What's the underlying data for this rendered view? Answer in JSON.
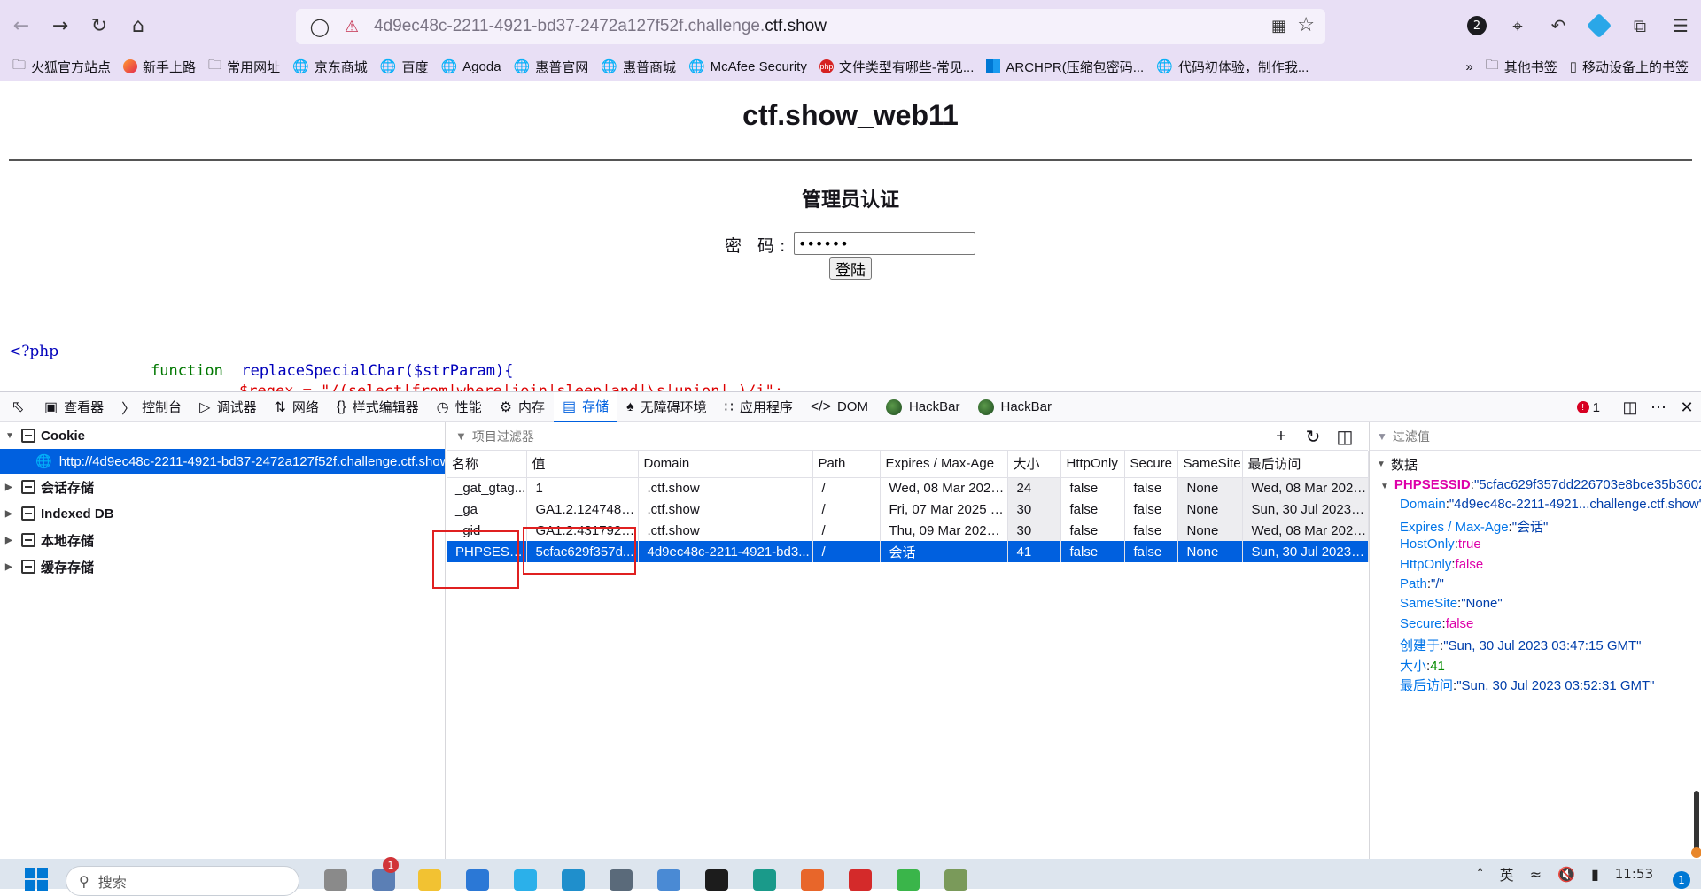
{
  "browser": {
    "url_prefix": "4d9ec48c-2211-4921-bd37-2472a127f52f.challenge.",
    "url_domain": "ctf.show",
    "notif_count": "2",
    "bookmarks": [
      {
        "label": "火狐官方站点",
        "icon": "folder-icon"
      },
      {
        "label": "新手上路",
        "icon": "firefox-icon"
      },
      {
        "label": "常用网址",
        "icon": "folder-icon"
      },
      {
        "label": "京东商城",
        "icon": "globe-icon"
      },
      {
        "label": "百度",
        "icon": "globe-icon"
      },
      {
        "label": "Agoda",
        "icon": "globe-icon"
      },
      {
        "label": "惠普官网",
        "icon": "globe-icon"
      },
      {
        "label": "惠普商城",
        "icon": "globe-icon"
      },
      {
        "label": "McAfee Security",
        "icon": "globe-icon"
      },
      {
        "label": "文件类型有哪些-常见...",
        "icon": "php-icon"
      },
      {
        "label": "ARCHPR(压缩包密码...",
        "icon": "microsoft-icon"
      },
      {
        "label": "代码初体验，制作我...",
        "icon": "globe-icon"
      }
    ],
    "other_bookmarks": "其他书签",
    "mobile_bookmarks": "移动设备上的书签"
  },
  "page": {
    "title": "ctf.show_web11",
    "heading": "管理员认证",
    "password_label": "密 码:",
    "password_value": "••••••",
    "login_button": "登陆",
    "php_open": "<?php",
    "php_keyword": "function",
    "php_function": "replaceSpecialChar($strParam){",
    "php_next_line": "$regex = \"/(select|from|where|join|sleep|and|\\s|union|,)/i\";"
  },
  "devtools": {
    "tabs": [
      {
        "label": "查看器",
        "icon": "inspector-icon"
      },
      {
        "label": "控制台",
        "icon": "console-icon"
      },
      {
        "label": "调试器",
        "icon": "debugger-icon"
      },
      {
        "label": "网络",
        "icon": "network-icon"
      },
      {
        "label": "样式编辑器",
        "icon": "style-editor-icon"
      },
      {
        "label": "性能",
        "icon": "performance-icon"
      },
      {
        "label": "内存",
        "icon": "memory-icon"
      },
      {
        "label": "存储",
        "icon": "storage-icon"
      },
      {
        "label": "无障碍环境",
        "icon": "accessibility-icon"
      },
      {
        "label": "应用程序",
        "icon": "application-icon"
      },
      {
        "label": "DOM",
        "icon": "dom-icon"
      },
      {
        "label": "HackBar",
        "icon": "hackbar-icon"
      },
      {
        "label": "HackBar",
        "icon": "hackbar-icon"
      }
    ],
    "active_tab": "存储",
    "error_count": "1",
    "sidebar": {
      "cookie": "Cookie",
      "cookie_host": "http://4d9ec48c-2211-4921-bd37-2472a127f52f.challenge.ctf.show",
      "session_storage": "会话存储",
      "indexed_db": "Indexed DB",
      "local_storage": "本地存储",
      "cache_storage": "缓存存储"
    },
    "filter_placeholder": "项目过滤器",
    "columns": [
      "名称",
      "值",
      "Domain",
      "Path",
      "Expires / Max-Age",
      "大小",
      "HttpOnly",
      "Secure",
      "SameSite",
      "最后访问"
    ],
    "rows": [
      [
        "_gat_gtag...",
        "1",
        ".ctf.show",
        "/",
        "Wed, 08 Mar 2023...",
        "24",
        "false",
        "false",
        "None",
        "Wed, 08 Mar 2023..."
      ],
      [
        "_ga",
        "GA1.2.1247487...",
        ".ctf.show",
        "/",
        "Fri, 07 Mar 2025 0...",
        "30",
        "false",
        "false",
        "None",
        "Sun, 30 Jul 2023 0..."
      ],
      [
        "_gid",
        "GA1.2.4317923...",
        ".ctf.show",
        "/",
        "Thu, 09 Mar 2023 ...",
        "30",
        "false",
        "false",
        "None",
        "Wed, 08 Mar 2023..."
      ],
      [
        "PHPSESSID",
        "5cfac629f357d...",
        "4d9ec48c-2211-4921-bd3...",
        "/",
        "会话",
        "41",
        "false",
        "false",
        "None",
        "Sun, 30 Jul 2023 0..."
      ]
    ],
    "detail": {
      "filter_placeholder": "过滤值",
      "section": "数据",
      "cookie_name": "PHPSESSID",
      "cookie_value": "\"5cfac629f357dd226703e8bce35b3602\"",
      "fields": [
        {
          "key": "Domain",
          "value": "\"4d9ec48c-2211-4921...challenge.ctf.show\"",
          "kind": "string"
        },
        {
          "key": "Expires / Max-Age",
          "value": "\"会话\"",
          "kind": "string"
        },
        {
          "key": "HostOnly",
          "value": "true",
          "kind": "bool"
        },
        {
          "key": "HttpOnly",
          "value": "false",
          "kind": "bool"
        },
        {
          "key": "Path",
          "value": "\"/\"",
          "kind": "string"
        },
        {
          "key": "SameSite",
          "value": "\"None\"",
          "kind": "string"
        },
        {
          "key": "Secure",
          "value": "false",
          "kind": "bool"
        },
        {
          "key": "创建于",
          "value": "\"Sun, 30 Jul 2023 03:47:15 GMT\"",
          "kind": "string"
        },
        {
          "key": "大小",
          "value": "41",
          "kind": "number"
        },
        {
          "key": "最后访问",
          "value": "\"Sun, 30 Jul 2023 03:52:31 GMT\"",
          "kind": "string"
        }
      ]
    }
  },
  "taskbar": {
    "search_placeholder": "搜索",
    "mail_badge": "1",
    "ime": "英",
    "time": "11:53",
    "notification_count": "1"
  },
  "colors": {
    "accent": "#0060df",
    "chrome_bg": "#e8dff5",
    "highlight_box": "#e02020"
  }
}
